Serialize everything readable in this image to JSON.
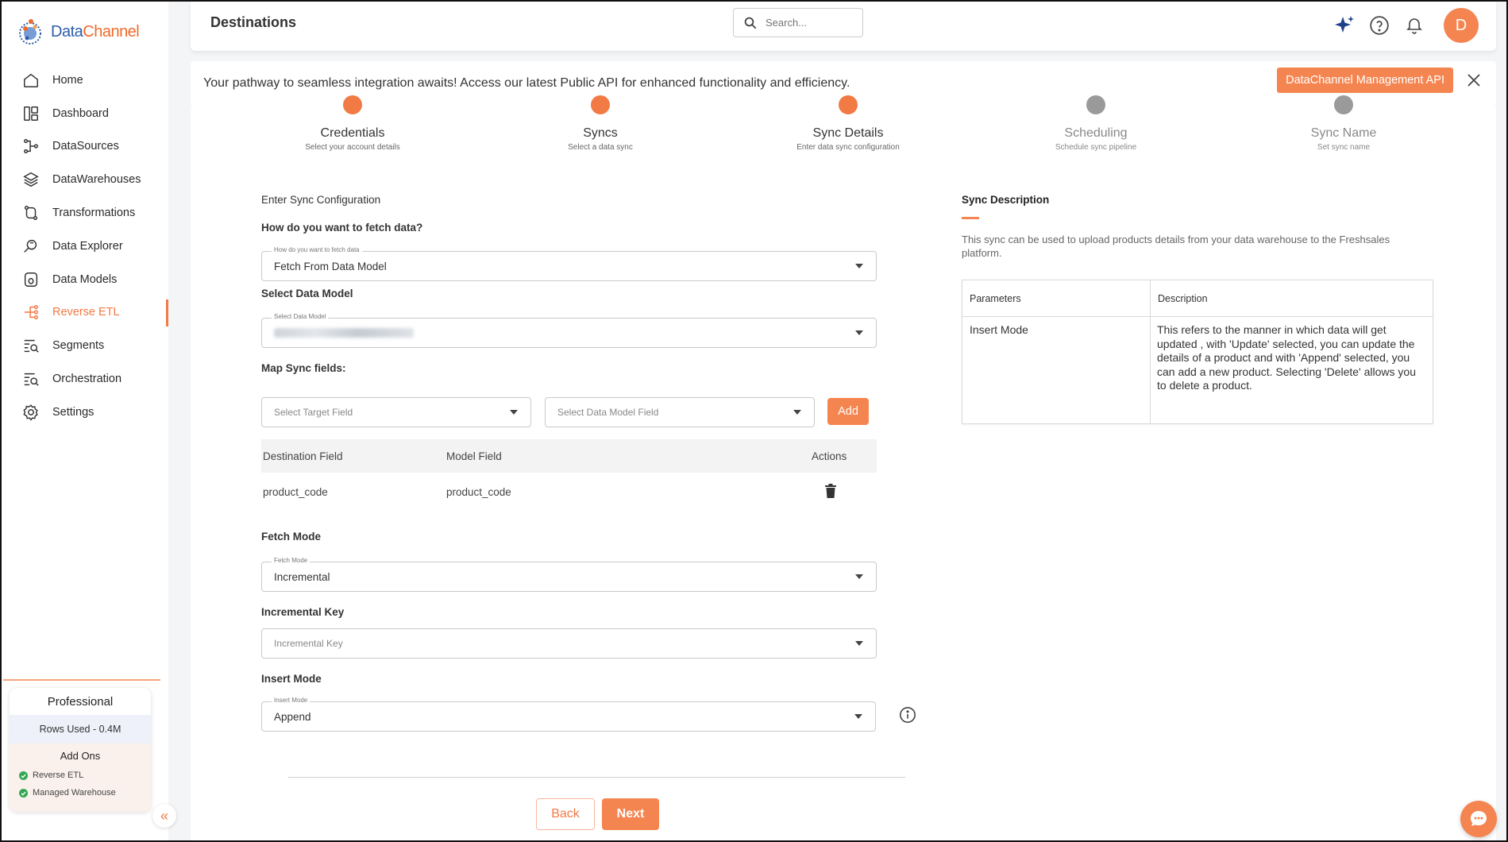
{
  "brand": {
    "name_part1": "Data",
    "name_part2": "Channel"
  },
  "sidebar": {
    "items": [
      {
        "label": "Home",
        "icon": "home-icon"
      },
      {
        "label": "Dashboard",
        "icon": "dashboard-icon"
      },
      {
        "label": "DataSources",
        "icon": "datasources-icon"
      },
      {
        "label": "DataWarehouses",
        "icon": "layers-icon"
      },
      {
        "label": "Transformations",
        "icon": "transform-icon"
      },
      {
        "label": "Data Explorer",
        "icon": "explorer-icon"
      },
      {
        "label": "Data Models",
        "icon": "database-icon"
      },
      {
        "label": "Reverse ETL",
        "icon": "reverse-etl-icon",
        "active": true
      },
      {
        "label": "Segments",
        "icon": "segments-icon"
      },
      {
        "label": "Orchestration",
        "icon": "orchestration-icon"
      },
      {
        "label": "Settings",
        "icon": "gear-icon"
      }
    ],
    "plan": {
      "name": "Professional",
      "rows_used": "Rows Used - 0.4M",
      "addons_title": "Add Ons",
      "addons": [
        "Reverse ETL",
        "Managed Warehouse"
      ]
    }
  },
  "header": {
    "title": "Destinations",
    "search_placeholder": "Search...",
    "avatar_initial": "D"
  },
  "banner": {
    "text": "Your pathway to seamless integration awaits! Access our latest Public API for enhanced functionality and efficiency.",
    "button_label": "DataChannel Management API"
  },
  "steps": [
    {
      "title": "Credentials",
      "subtitle": "Select your account details",
      "state": "done"
    },
    {
      "title": "Syncs",
      "subtitle": "Select a data sync",
      "state": "done"
    },
    {
      "title": "Sync Details",
      "subtitle": "Enter data sync configuration",
      "state": "current"
    },
    {
      "title": "Scheduling",
      "subtitle": "Schedule sync pipeline",
      "state": "future"
    },
    {
      "title": "Sync Name",
      "subtitle": "Set sync name",
      "state": "future"
    }
  ],
  "form": {
    "section_title": "Enter Sync Configuration",
    "fetch_label": "How do you want to fetch data?",
    "fetch_float": "How do you want to fetch data",
    "fetch_value": "Fetch From Data Model",
    "model_label": "Select Data Model",
    "model_float": "Select Data Model",
    "map_label": "Map Sync fields:",
    "target_placeholder": "Select Target Field",
    "model_field_placeholder": "Select Data Model Field",
    "add_label": "Add",
    "table_headers": [
      "Destination Field",
      "Model Field",
      "Actions"
    ],
    "mappings": [
      {
        "destination": "product_code",
        "model": "product_code"
      }
    ],
    "fetch_mode_label": "Fetch Mode",
    "fetch_mode_float": "Fetch Mode",
    "fetch_mode_value": "Incremental",
    "inc_key_label": "Incremental Key",
    "inc_key_placeholder": "Incremental Key",
    "insert_mode_label": "Insert Mode",
    "insert_mode_float": "Insert Mode",
    "insert_mode_value": "Append",
    "back_label": "Back",
    "next_label": "Next"
  },
  "description": {
    "title": "Sync Description",
    "text": "This sync can be used to upload products details from your data warehouse to the Freshsales platform.",
    "table_headers": [
      "Parameters",
      "Description"
    ],
    "rows": [
      {
        "param": "Insert Mode",
        "desc": "This refers to the manner in which data will get updated , with 'Update' selected, you can update the details of a product and with 'Append' selected, you can add a new product. Selecting 'Delete' allows you to delete a product."
      }
    ]
  },
  "colors": {
    "accent": "#f58550",
    "done_step": "#f27a45",
    "future_step": "#9a9a9a"
  }
}
